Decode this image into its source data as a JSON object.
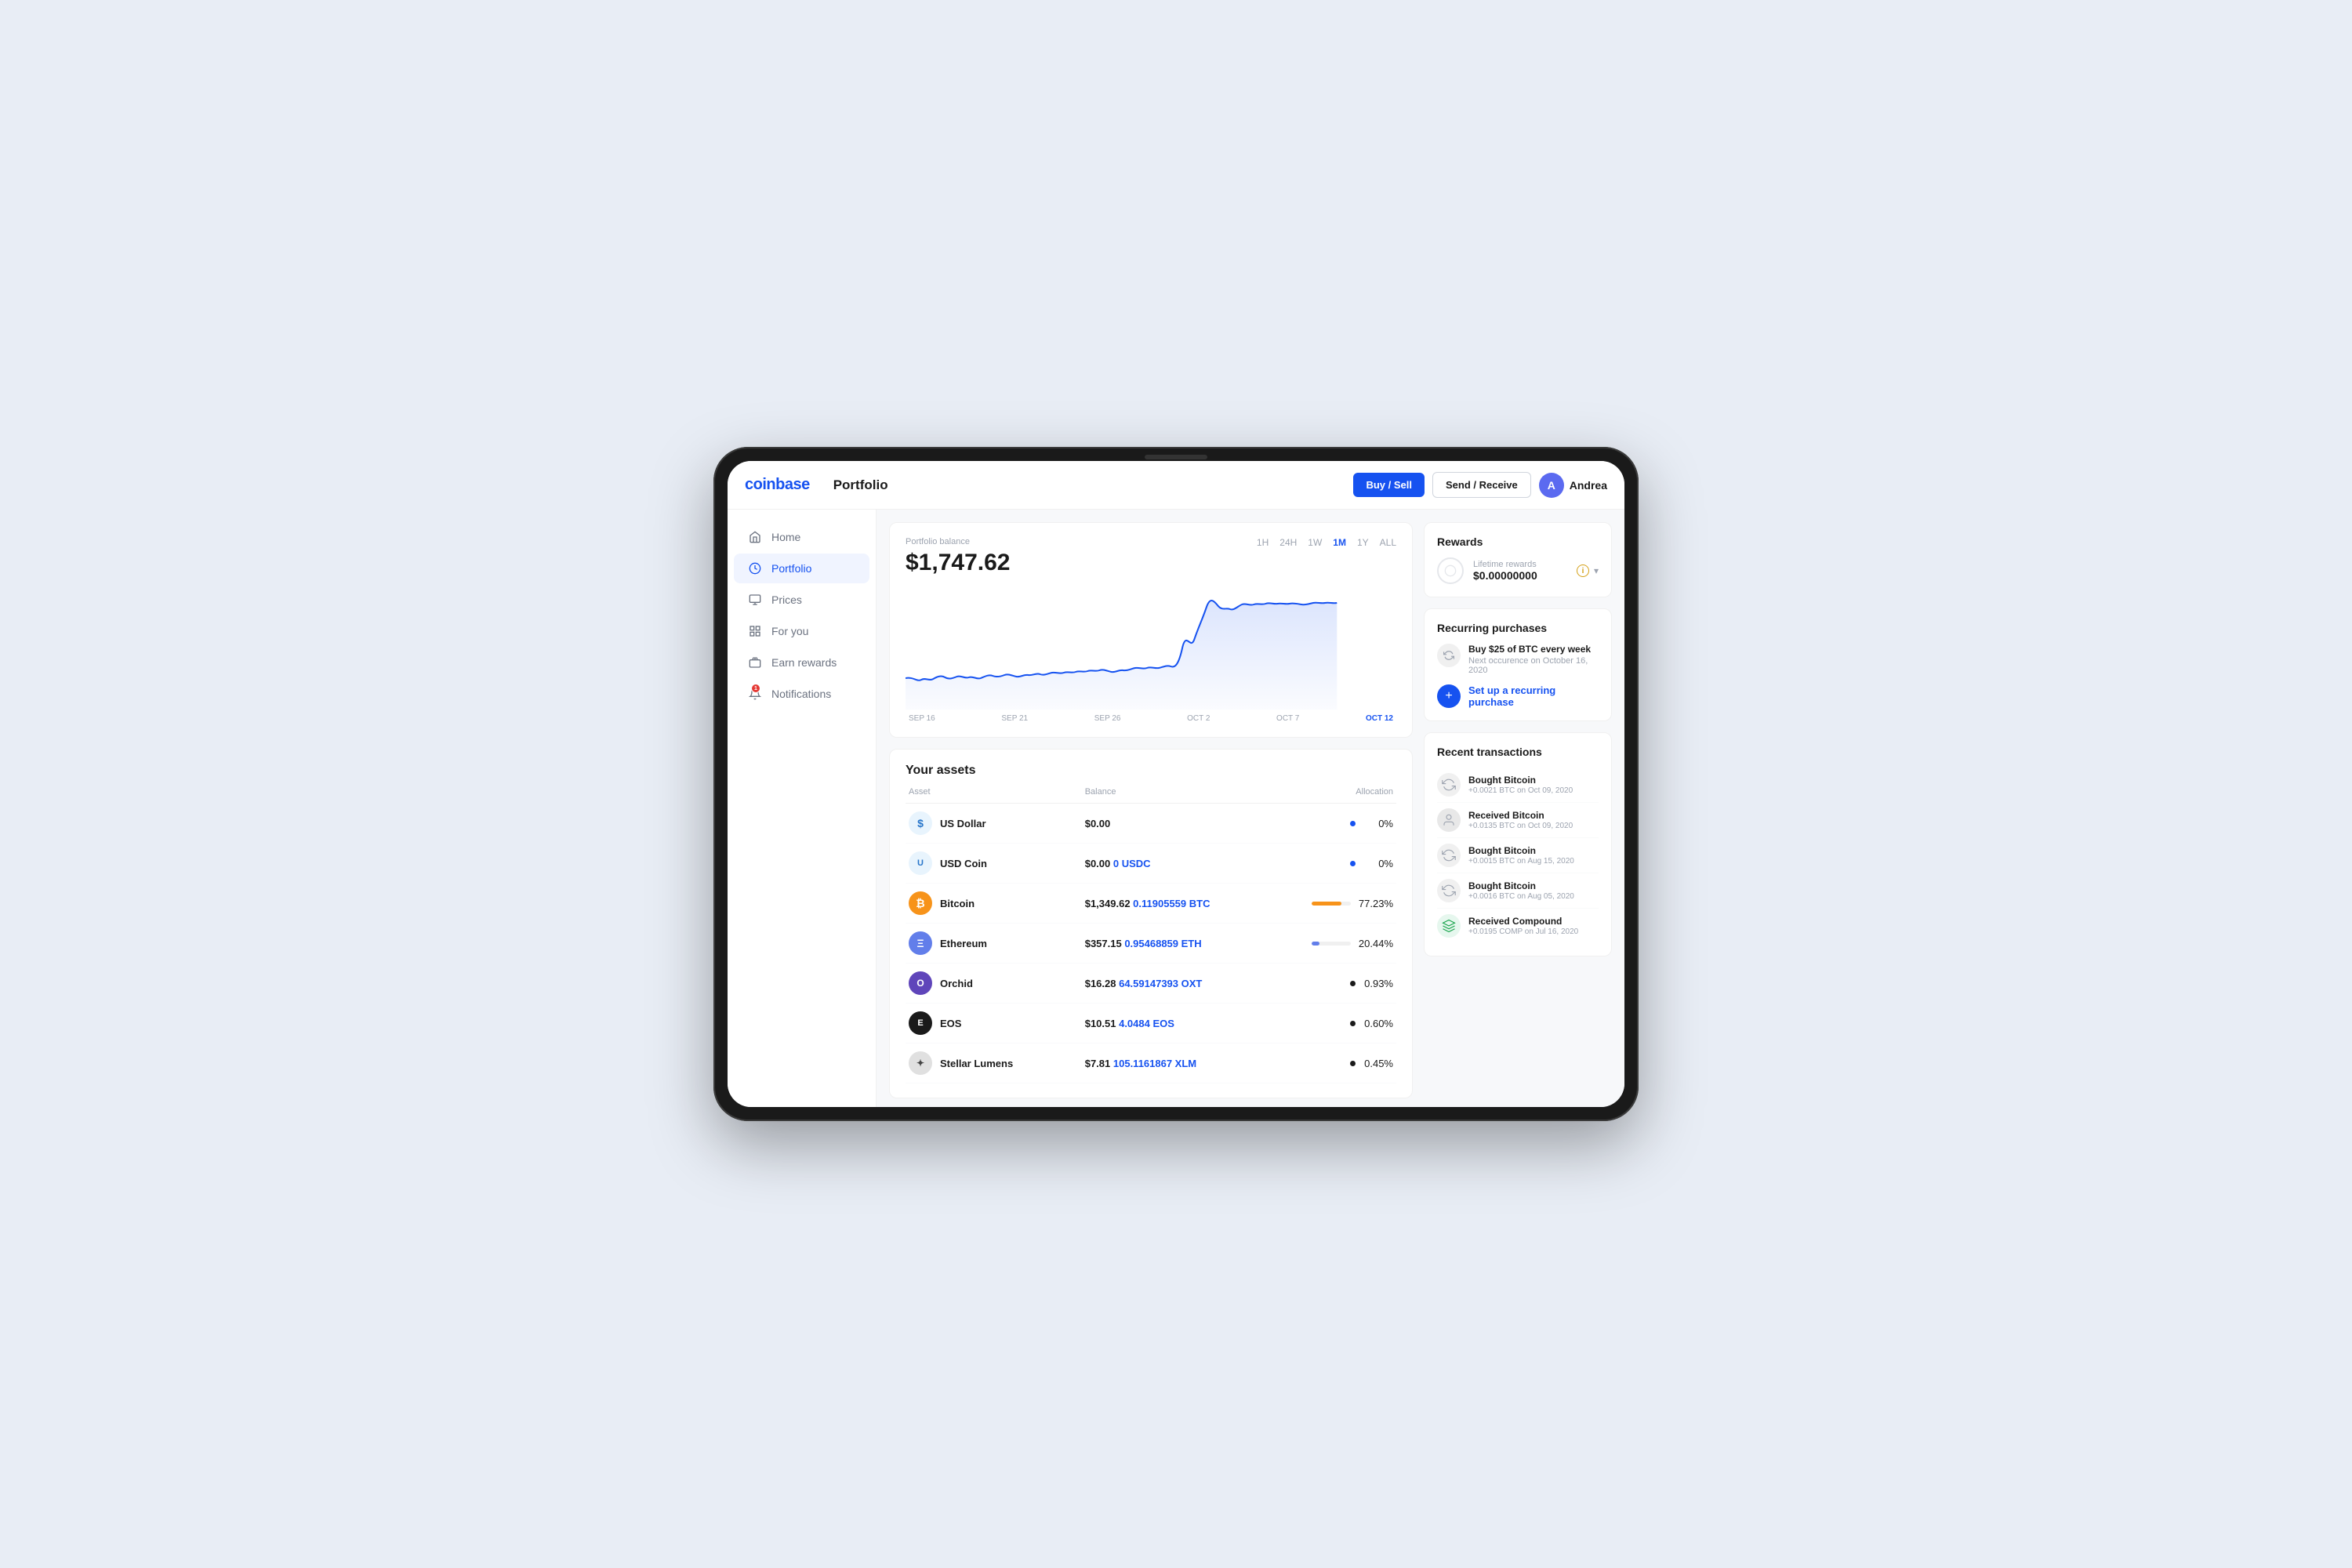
{
  "header": {
    "logo": "coinbase",
    "page_title": "Portfolio",
    "btn_buy_sell": "Buy / Sell",
    "btn_send_receive": "Send / Receive",
    "user_name": "Andrea"
  },
  "sidebar": {
    "items": [
      {
        "id": "home",
        "label": "Home",
        "icon": "home"
      },
      {
        "id": "portfolio",
        "label": "Portfolio",
        "icon": "portfolio",
        "active": true
      },
      {
        "id": "prices",
        "label": "Prices",
        "icon": "prices"
      },
      {
        "id": "for-you",
        "label": "For you",
        "icon": "for-you"
      },
      {
        "id": "earn-rewards",
        "label": "Earn rewards",
        "icon": "earn-rewards"
      },
      {
        "id": "notifications",
        "label": "Notifications",
        "icon": "notifications",
        "badge": "1"
      }
    ]
  },
  "chart": {
    "balance_label": "Portfolio balance",
    "balance": "$1,747.62",
    "time_filters": [
      "1H",
      "24H",
      "1W",
      "1M",
      "1Y",
      "ALL"
    ],
    "active_filter": "1M",
    "dates": [
      "SEP 16",
      "SEP 21",
      "SEP 26",
      "OCT 2",
      "OCT 7",
      "OCT 12"
    ]
  },
  "assets": {
    "title": "Your assets",
    "columns": [
      "Asset",
      "Balance",
      "Allocation"
    ],
    "rows": [
      {
        "id": "usd",
        "name": "US Dollar",
        "icon_color": "#2775ca",
        "icon_text": "$",
        "usd": "$0.00",
        "crypto": "",
        "alloc_pct": "0%",
        "bar_pct": 0,
        "bar_color": "#1652f0",
        "dot": true
      },
      {
        "id": "usdc",
        "name": "USD Coin",
        "icon_color": "#2775ca",
        "icon_text": "U",
        "usd": "$0.00",
        "crypto": "0 USDC",
        "alloc_pct": "0%",
        "bar_pct": 0,
        "bar_color": "#1652f0",
        "dot": true
      },
      {
        "id": "btc",
        "name": "Bitcoin",
        "icon_color": "#f7931a",
        "icon_text": "₿",
        "usd": "$1,349.62",
        "crypto": "0.11905559 BTC",
        "alloc_pct": "77.23%",
        "bar_pct": 77,
        "bar_color": "#f7931a",
        "dot": false
      },
      {
        "id": "eth",
        "name": "Ethereum",
        "icon_color": "#627eea",
        "icon_text": "Ξ",
        "usd": "$357.15",
        "crypto": "0.95468859 ETH",
        "alloc_pct": "20.44%",
        "bar_pct": 20,
        "bar_color": "#627eea",
        "dot": false
      },
      {
        "id": "oxt",
        "name": "Orchid",
        "icon_color": "#5f45ba",
        "icon_text": "O",
        "usd": "$16.28",
        "crypto": "64.59147393 OXT",
        "alloc_pct": "0.93%",
        "bar_pct": 1,
        "bar_color": "#1a1a1a",
        "dot": true
      },
      {
        "id": "eos",
        "name": "EOS",
        "icon_color": "#1a1a1a",
        "icon_text": "E",
        "usd": "$10.51",
        "crypto": "4.0484 EOS",
        "alloc_pct": "0.60%",
        "bar_pct": 1,
        "bar_color": "#1a1a1a",
        "dot": true
      },
      {
        "id": "xlm",
        "name": "Stellar Lumens",
        "icon_color": "#444444",
        "icon_text": "✦",
        "usd": "$7.81",
        "crypto": "105.1161867 XLM",
        "alloc_pct": "0.45%",
        "bar_pct": 0,
        "bar_color": "#1a1a1a",
        "dot": true
      }
    ]
  },
  "rewards": {
    "section_title": "Rewards",
    "lifetime_label": "Lifetime rewards",
    "lifetime_amount": "$0.00000000"
  },
  "recurring": {
    "section_title": "Recurring purchases",
    "item_title": "Buy $25 of BTC every week",
    "item_sub": "Next occurence on October 16, 2020",
    "setup_label": "Set up a recurring purchase"
  },
  "transactions": {
    "section_title": "Recent transactions",
    "items": [
      {
        "title": "Bought Bitcoin",
        "sub": "+0.0021 BTC on Oct 09, 2020",
        "type": "bought-btc"
      },
      {
        "title": "Received Bitcoin",
        "sub": "+0.0135 BTC on Oct 09, 2020",
        "type": "received-btc"
      },
      {
        "title": "Bought Bitcoin",
        "sub": "+0.0015 BTC on Aug 15, 2020",
        "type": "bought-btc"
      },
      {
        "title": "Bought Bitcoin",
        "sub": "+0.0016 BTC on Aug 05, 2020",
        "type": "bought-btc"
      },
      {
        "title": "Received Compound",
        "sub": "+0.0195 COMP on Jul 16, 2020",
        "type": "received-comp"
      }
    ]
  }
}
